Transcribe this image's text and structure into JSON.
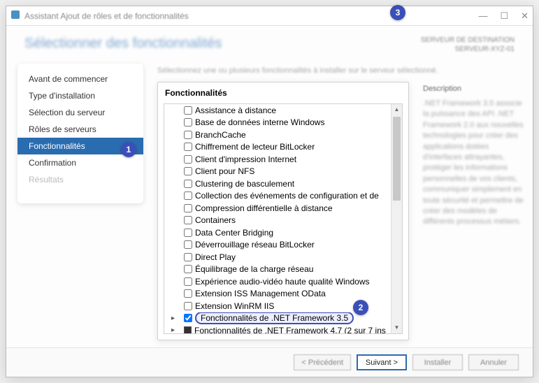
{
  "window": {
    "title": "Assistant Ajout de rôles et de fonctionnalités",
    "heading": "Sélectionner des fonctionnalités",
    "meta_line1": "SERVEUR DE DESTINATION",
    "meta_line2": "SERVEUR-XYZ-01"
  },
  "nav": {
    "items": [
      {
        "label": "Avant de commencer",
        "state": "normal"
      },
      {
        "label": "Type d'installation",
        "state": "normal"
      },
      {
        "label": "Sélection du serveur",
        "state": "normal"
      },
      {
        "label": "Rôles de serveurs",
        "state": "normal"
      },
      {
        "label": "Fonctionnalités",
        "state": "active"
      },
      {
        "label": "Confirmation",
        "state": "normal"
      },
      {
        "label": "Résultats",
        "state": "disabled"
      }
    ]
  },
  "intro": "Sélectionnez une ou plusieurs fonctionnalités à installer sur le serveur sélectionné.",
  "panel": {
    "title": "Fonctionnalités"
  },
  "features": [
    {
      "label": "Assistance à distance",
      "checked": false
    },
    {
      "label": "Base de données interne Windows",
      "checked": false
    },
    {
      "label": "BranchCache",
      "checked": false
    },
    {
      "label": "Chiffrement de lecteur BitLocker",
      "checked": false
    },
    {
      "label": "Client d'impression Internet",
      "checked": false
    },
    {
      "label": "Client pour NFS",
      "checked": false
    },
    {
      "label": "Clustering de basculement",
      "checked": false
    },
    {
      "label": "Collection des événements de configuration et de",
      "checked": false
    },
    {
      "label": "Compression différentielle à distance",
      "checked": false
    },
    {
      "label": "Containers",
      "checked": false
    },
    {
      "label": "Data Center Bridging",
      "checked": false
    },
    {
      "label": "Déverrouillage réseau BitLocker",
      "checked": false
    },
    {
      "label": "Direct Play",
      "checked": false
    },
    {
      "label": "Équilibrage de la charge réseau",
      "checked": false
    },
    {
      "label": "Expérience audio-vidéo haute qualité Windows",
      "checked": false
    },
    {
      "label": "Extension ISS Management OData",
      "checked": false
    },
    {
      "label": "Extension WinRM IIS",
      "checked": false
    },
    {
      "label": "Fonctionnalités de .NET Framework 3.5",
      "checked": true,
      "expandable": true,
      "highlighted": true
    },
    {
      "label": "Fonctionnalités de .NET Framework 4.7 (2 sur 7 ins",
      "partial": true,
      "expandable": true
    }
  ],
  "description": {
    "title": "Description",
    "body": ".NET Framework 3.5 associe la puissance des API .NET Framework 2.0 aux nouvelles technologies pour créer des applications dotées d'interfaces attrayantes, protéger les informations personnelles de vos clients, communiquer simplement en toute sécurité et permettre de créer des modèles de différents processus métiers."
  },
  "footer": {
    "prev": "< Précédent",
    "next": "Suivant >",
    "install": "Installer",
    "cancel": "Annuler"
  },
  "callouts": {
    "c1": "1",
    "c2": "2",
    "c3": "3"
  }
}
